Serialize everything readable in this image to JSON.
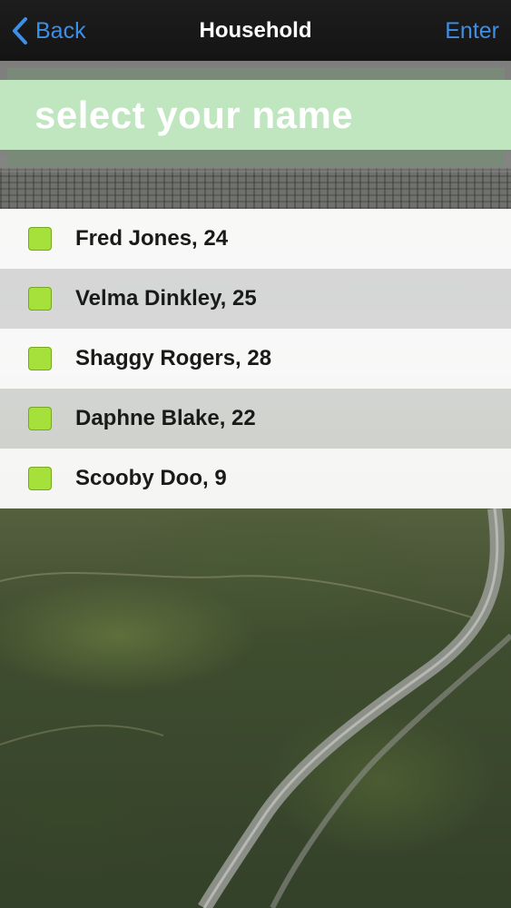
{
  "navbar": {
    "back_label": "Back",
    "title": "Household",
    "enter_label": "Enter",
    "accent_color": "#3d8fe6"
  },
  "banner": {
    "text": "select your name",
    "band_color": "#bfe6bf"
  },
  "people": [
    {
      "label": "Fred Jones, 24"
    },
    {
      "label": "Velma Dinkley, 25"
    },
    {
      "label": "Shaggy Rogers, 28"
    },
    {
      "label": "Daphne Blake, 22"
    },
    {
      "label": "Scooby Doo, 9"
    }
  ],
  "checkbox_color": "#a6e03a",
  "icons": {
    "back": "chevron-left-icon",
    "checkbox": "checkbox-icon"
  }
}
